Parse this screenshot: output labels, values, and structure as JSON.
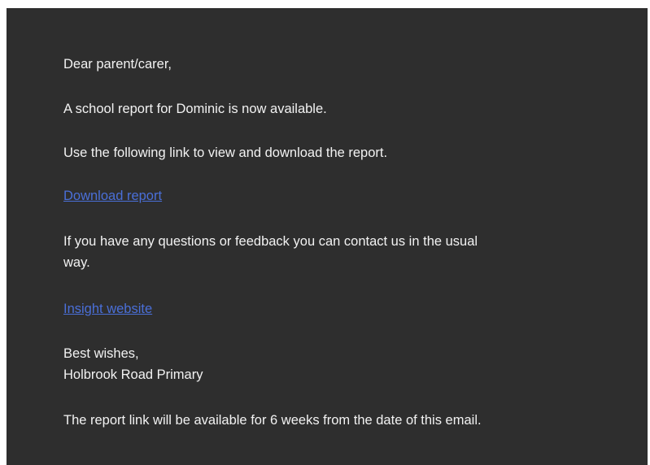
{
  "email": {
    "greeting": "Dear parent/carer,",
    "report_available": "A school report for Dominic is now available.",
    "instructions": "Use the following link to view and download the report.",
    "download_link_label": "Download report",
    "questions_line1": "If you have any questions or feedback you can contact us in the usual",
    "questions_line2": "way.",
    "website_link_label": "Insight website",
    "signoff": "Best wishes,",
    "school_name": "Holbrook Road Primary",
    "availability_note": "The report link will be available for 6 weeks from the date of this email."
  },
  "colors": {
    "background": "#2e2e2e",
    "text": "#f2f2f2",
    "link": "#4a6fd8"
  }
}
